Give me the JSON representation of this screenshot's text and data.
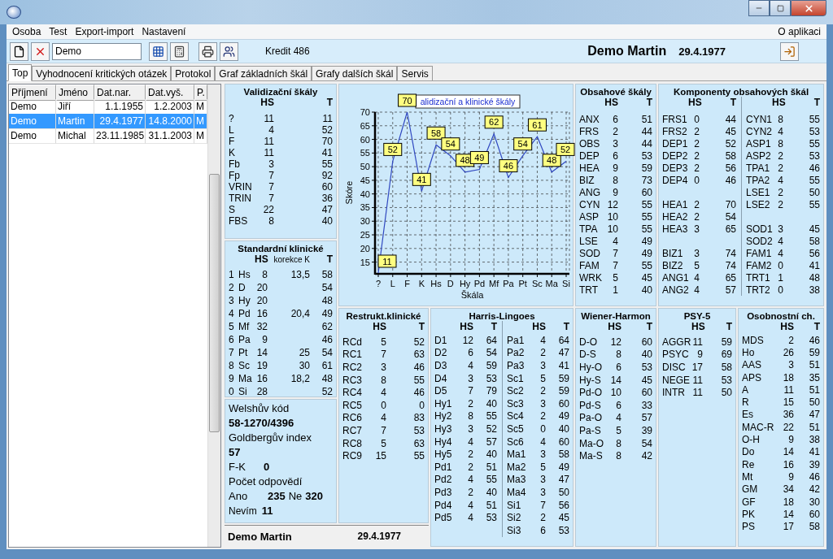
{
  "menu": {
    "items": [
      "Osoba",
      "Test",
      "Export-import",
      "Nastavení"
    ],
    "right": "O aplikaci"
  },
  "toolbar": {
    "search_value": "Demo",
    "credit": "Kredit 486",
    "person": "Demo Martin",
    "birth_date": "29.4.1977"
  },
  "tabs": [
    {
      "label": "Top",
      "selected": true
    },
    {
      "label": "Vyhodnocení kritických otázek",
      "selected": false
    },
    {
      "label": "Protokol",
      "selected": false
    },
    {
      "label": "Graf základních škál",
      "selected": false
    },
    {
      "label": "Grafy dalších škál",
      "selected": false
    },
    {
      "label": "Servis",
      "selected": false
    }
  ],
  "person_list": {
    "columns": [
      "Příjmení",
      "Jméno",
      "Dat.nar.",
      "Dat.vyš.",
      "P."
    ],
    "rows": [
      {
        "cells": [
          "Demo",
          "Jiří",
          "1.1.1955",
          "1.2.2003",
          "M"
        ],
        "selected": false
      },
      {
        "cells": [
          "Demo",
          "Martin",
          "29.4.1977",
          "14.8.2000",
          "M"
        ],
        "selected": true
      },
      {
        "cells": [
          "Demo",
          "Michal",
          "23.11.1985",
          "31.1.2003",
          "M"
        ],
        "selected": false
      }
    ]
  },
  "validation": {
    "title": "Validizační škály",
    "headers": [
      "HS",
      "T"
    ],
    "rows": [
      {
        "scale": "?",
        "hs": "11",
        "t": "11"
      },
      {
        "scale": "L",
        "hs": "4",
        "t": "52"
      },
      {
        "scale": "F",
        "hs": "11",
        "t": "70"
      },
      {
        "scale": "K",
        "hs": "11",
        "t": "41"
      },
      {
        "scale": "Fb",
        "hs": "3",
        "t": "55"
      },
      {
        "scale": "Fp",
        "hs": "7",
        "t": "92"
      },
      {
        "scale": "VRIN",
        "hs": "7",
        "t": "60"
      },
      {
        "scale": "TRIN",
        "hs": "7",
        "t": "36"
      },
      {
        "scale": "S",
        "hs": "22",
        "t": "47"
      },
      {
        "scale": "FBS",
        "hs": "8",
        "t": "40"
      }
    ]
  },
  "standard": {
    "title": "Standardní klinické",
    "headers": [
      "HS",
      "korekce K",
      "T"
    ],
    "rows": [
      {
        "no": "1",
        "scale": "Hs",
        "hs": "8",
        "k": "13,5",
        "t": "58"
      },
      {
        "no": "2",
        "scale": "D",
        "hs": "20",
        "t": "54"
      },
      {
        "no": "3",
        "scale": "Hy",
        "hs": "20",
        "t": "48"
      },
      {
        "no": "4",
        "scale": "Pd",
        "hs": "16",
        "k": "20,4",
        "t": "49"
      },
      {
        "no": "5",
        "scale": "Mf",
        "hs": "32",
        "t": "62"
      },
      {
        "no": "6",
        "scale": "Pa",
        "hs": "9",
        "t": "46"
      },
      {
        "no": "7",
        "scale": "Pt",
        "hs": "14",
        "k": "25",
        "t": "54"
      },
      {
        "no": "8",
        "scale": "Sc",
        "hs": "19",
        "k": "30",
        "t": "61"
      },
      {
        "no": "9",
        "scale": "Ma",
        "hs": "16",
        "k": "18,2",
        "t": "48"
      },
      {
        "no": "0",
        "scale": "Si",
        "hs": "28",
        "t": "52"
      }
    ]
  },
  "summary": {
    "welsh_label": "Welshův kód",
    "welsh_code": "58-1270/4396",
    "goldberg_label": "Goldbergův index",
    "goldberg_index": "57",
    "fk_label": "F-K",
    "fk_value": "0",
    "answers_label": "Počet odpovědí",
    "yes_label": "Ano",
    "yes_count": "235",
    "no_label": "Ne",
    "no_count": "320",
    "unknown_label": "Nevím",
    "unknown_count": "11"
  },
  "footer": {
    "name": "Demo Martin",
    "date": "29.4.1977"
  },
  "chart": {
    "chart_data": {
      "type": "line",
      "title": "alidizační a klinické škály",
      "xlabel": "Škála",
      "ylabel": "Skóre",
      "categories": [
        "?",
        "L",
        "F",
        "K",
        "Hs",
        "D",
        "Hy",
        "Pd",
        "Mf",
        "Pa",
        "Pt",
        "Sc",
        "Ma",
        "Si"
      ],
      "series": [
        {
          "color": "#3048c0",
          "values": [
            11,
            52,
            70,
            41,
            58,
            54,
            48,
            49,
            62,
            46,
            54,
            61,
            48,
            52
          ]
        }
      ],
      "ylim": [
        11,
        70
      ],
      "grid": true,
      "yticks": [
        15,
        20,
        25,
        30,
        35,
        40,
        45,
        50,
        55,
        60,
        65,
        70
      ],
      "data_labels": true
    }
  },
  "content": {
    "title": "Obsahové škály",
    "headers": [
      "HS",
      "T"
    ],
    "rows": [
      {
        "scale": "ANX",
        "hs": "6",
        "t": "51"
      },
      {
        "scale": "FRS",
        "hs": "2",
        "t": "44"
      },
      {
        "scale": "OBS",
        "hs": "3",
        "t": "44"
      },
      {
        "scale": "DEP",
        "hs": "6",
        "t": "53"
      },
      {
        "scale": "HEA",
        "hs": "9",
        "t": "59"
      },
      {
        "scale": "BIZ",
        "hs": "8",
        "t": "73"
      },
      {
        "scale": "ANG",
        "hs": "9",
        "t": "60"
      },
      {
        "scale": "CYN",
        "hs": "12",
        "t": "55"
      },
      {
        "scale": "ASP",
        "hs": "10",
        "t": "55"
      },
      {
        "scale": "TPA",
        "hs": "10",
        "t": "55"
      },
      {
        "scale": "LSE",
        "hs": "4",
        "t": "49"
      },
      {
        "scale": "SOD",
        "hs": "7",
        "t": "49"
      },
      {
        "scale": "FAM",
        "hs": "7",
        "t": "55"
      },
      {
        "scale": "WRK",
        "hs": "5",
        "t": "45"
      },
      {
        "scale": "TRT",
        "hs": "1",
        "t": "40"
      }
    ]
  },
  "components": {
    "title": "Komponenty obsahových škál",
    "headers": [
      "HS",
      "T",
      "HS",
      "T"
    ],
    "groups": [
      {
        "rows": [
          {
            "kind": "score",
            "scale": "FRS1",
            "hs": "0",
            "t": "44"
          },
          {
            "kind": "score",
            "scale": "FRS2",
            "hs": "2",
            "t": "45"
          },
          {
            "kind": "score",
            "scale": "DEP1",
            "hs": "2",
            "t": "52"
          },
          {
            "kind": "score",
            "scale": "DEP2",
            "hs": "2",
            "t": "58"
          },
          {
            "kind": "score",
            "scale": "DEP3",
            "hs": "2",
            "t": "56"
          },
          {
            "kind": "score",
            "scale": "DEP4",
            "hs": "0",
            "t": "46"
          },
          {
            "kind": "gap"
          },
          {
            "kind": "score",
            "scale": "HEA1",
            "hs": "2",
            "t": "70"
          },
          {
            "kind": "score",
            "scale": "HEA2",
            "hs": "2",
            "t": "54"
          },
          {
            "kind": "score",
            "scale": "HEA3",
            "hs": "3",
            "t": "65"
          },
          {
            "kind": "gap"
          },
          {
            "kind": "score",
            "scale": "BIZ1",
            "hs": "3",
            "t": "74"
          },
          {
            "kind": "score",
            "scale": "BIZ2",
            "hs": "5",
            "t": "74"
          },
          {
            "kind": "score",
            "scale": "ANG1",
            "hs": "4",
            "t": "65"
          },
          {
            "kind": "score",
            "scale": "ANG2",
            "hs": "4",
            "t": "57"
          }
        ]
      },
      {
        "rows": [
          {
            "kind": "score",
            "scale": "CYN1",
            "hs": "8",
            "t": "55"
          },
          {
            "kind": "score",
            "scale": "CYN2",
            "hs": "4",
            "t": "53"
          },
          {
            "kind": "score",
            "scale": "ASP1",
            "hs": "8",
            "t": "55"
          },
          {
            "kind": "score",
            "scale": "ASP2",
            "hs": "2",
            "t": "53"
          },
          {
            "kind": "score",
            "scale": "TPA1",
            "hs": "2",
            "t": "46"
          },
          {
            "kind": "score",
            "scale": "TPA2",
            "hs": "4",
            "t": "55"
          },
          {
            "kind": "score",
            "scale": "LSE1",
            "hs": "2",
            "t": "50"
          },
          {
            "kind": "score",
            "scale": "LSE2",
            "hs": "2",
            "t": "55"
          },
          {
            "kind": "gap"
          },
          {
            "kind": "score",
            "scale": "SOD1",
            "hs": "3",
            "t": "45"
          },
          {
            "kind": "score",
            "scale": "SOD2",
            "hs": "4",
            "t": "58"
          },
          {
            "kind": "score",
            "scale": "FAM1",
            "hs": "4",
            "t": "56"
          },
          {
            "kind": "score",
            "scale": "FAM2",
            "hs": "0",
            "t": "41"
          },
          {
            "kind": "score",
            "scale": "TRT1",
            "hs": "1",
            "t": "48"
          },
          {
            "kind": "score",
            "scale": "TRT2",
            "hs": "0",
            "t": "38"
          }
        ]
      }
    ]
  },
  "restructured": {
    "title": "Restrukt.klinické",
    "headers": [
      "HS",
      "T"
    ],
    "rows": [
      {
        "scale": "RCd",
        "hs": "5",
        "t": "52"
      },
      {
        "scale": "RC1",
        "hs": "7",
        "t": "63"
      },
      {
        "scale": "RC2",
        "hs": "3",
        "t": "46"
      },
      {
        "scale": "RC3",
        "hs": "8",
        "t": "55"
      },
      {
        "scale": "RC4",
        "hs": "4",
        "t": "46"
      },
      {
        "scale": "RC5",
        "hs": "0",
        "t": "0"
      },
      {
        "scale": "RC6",
        "hs": "4",
        "t": "83"
      },
      {
        "scale": "RC7",
        "hs": "7",
        "t": "53"
      },
      {
        "scale": "RC8",
        "hs": "5",
        "t": "63"
      },
      {
        "scale": "RC9",
        "hs": "15",
        "t": "55"
      }
    ]
  },
  "harris": {
    "title": "Harris-Lingoes",
    "headers": [
      "HS",
      "T",
      "HS",
      "T"
    ],
    "groups": [
      {
        "rows": [
          {
            "scale": "D1",
            "hs": "12",
            "t": "64"
          },
          {
            "scale": "D2",
            "hs": "6",
            "t": "54"
          },
          {
            "scale": "D3",
            "hs": "4",
            "t": "59"
          },
          {
            "scale": "D4",
            "hs": "3",
            "t": "53"
          },
          {
            "scale": "D5",
            "hs": "7",
            "t": "79"
          },
          {
            "scale": "Hy1",
            "hs": "2",
            "t": "40"
          },
          {
            "scale": "Hy2",
            "hs": "8",
            "t": "55"
          },
          {
            "scale": "Hy3",
            "hs": "3",
            "t": "52"
          },
          {
            "scale": "Hy4",
            "hs": "4",
            "t": "57"
          },
          {
            "scale": "Hy5",
            "hs": "2",
            "t": "40"
          },
          {
            "scale": "Pd1",
            "hs": "2",
            "t": "51"
          },
          {
            "scale": "Pd2",
            "hs": "4",
            "t": "55"
          },
          {
            "scale": "Pd3",
            "hs": "2",
            "t": "40"
          },
          {
            "scale": "Pd4",
            "hs": "4",
            "t": "51"
          },
          {
            "scale": "Pd5",
            "hs": "4",
            "t": "53"
          }
        ]
      },
      {
        "rows": [
          {
            "scale": "Pa1",
            "hs": "4",
            "t": "64"
          },
          {
            "scale": "Pa2",
            "hs": "2",
            "t": "47"
          },
          {
            "scale": "Pa3",
            "hs": "3",
            "t": "41"
          },
          {
            "scale": "Sc1",
            "hs": "5",
            "t": "59"
          },
          {
            "scale": "Sc2",
            "hs": "2",
            "t": "59"
          },
          {
            "scale": "Sc3",
            "hs": "3",
            "t": "60"
          },
          {
            "scale": "Sc4",
            "hs": "2",
            "t": "49"
          },
          {
            "scale": "Sc5",
            "hs": "0",
            "t": "40"
          },
          {
            "scale": "Sc6",
            "hs": "4",
            "t": "60"
          },
          {
            "scale": "Ma1",
            "hs": "3",
            "t": "58"
          },
          {
            "scale": "Ma2",
            "hs": "5",
            "t": "49"
          },
          {
            "scale": "Ma3",
            "hs": "3",
            "t": "47"
          },
          {
            "scale": "Ma4",
            "hs": "3",
            "t": "50"
          },
          {
            "scale": "Si1",
            "hs": "7",
            "t": "56"
          },
          {
            "scale": "Si2",
            "hs": "2",
            "t": "45"
          },
          {
            "scale": "Si3",
            "hs": "6",
            "t": "53"
          }
        ]
      }
    ]
  },
  "wiener": {
    "title": "Wiener-Harmon",
    "headers": [
      "HS",
      "T"
    ],
    "rows": [
      {
        "scale": "D-O",
        "hs": "12",
        "t": "60"
      },
      {
        "scale": "D-S",
        "hs": "8",
        "t": "40"
      },
      {
        "scale": "Hy-O",
        "hs": "6",
        "t": "53"
      },
      {
        "scale": "Hy-S",
        "hs": "14",
        "t": "45"
      },
      {
        "scale": "Pd-O",
        "hs": "10",
        "t": "60"
      },
      {
        "scale": "Pd-S",
        "hs": "6",
        "t": "33"
      },
      {
        "scale": "Pa-O",
        "hs": "4",
        "t": "57"
      },
      {
        "scale": "Pa-S",
        "hs": "5",
        "t": "39"
      },
      {
        "scale": "Ma-O",
        "hs": "8",
        "t": "54"
      },
      {
        "scale": "Ma-S",
        "hs": "8",
        "t": "42"
      }
    ]
  },
  "psy5": {
    "title": "PSY-5",
    "headers": [
      "HS",
      "T"
    ],
    "rows": [
      {
        "scale": "AGGR",
        "hs": "11",
        "t": "59"
      },
      {
        "scale": "PSYC",
        "hs": "9",
        "t": "69"
      },
      {
        "scale": "DISC",
        "hs": "17",
        "t": "58"
      },
      {
        "scale": "NEGE",
        "hs": "11",
        "t": "53"
      },
      {
        "scale": "INTR",
        "hs": "11",
        "t": "50"
      }
    ]
  },
  "personality": {
    "title": "Osobnostní ch.",
    "headers": [
      "HS",
      "T"
    ],
    "rows": [
      {
        "scale": "MDS",
        "hs": "2",
        "t": "46"
      },
      {
        "scale": "Ho",
        "hs": "26",
        "t": "59"
      },
      {
        "scale": "AAS",
        "hs": "3",
        "t": "51"
      },
      {
        "scale": "APS",
        "hs": "18",
        "t": "35"
      },
      {
        "scale": "A",
        "hs": "11",
        "t": "51"
      },
      {
        "scale": "R",
        "hs": "15",
        "t": "50"
      },
      {
        "scale": "Es",
        "hs": "36",
        "t": "47"
      },
      {
        "scale": "MAC-R",
        "hs": "22",
        "t": "51"
      },
      {
        "scale": "O-H",
        "hs": "9",
        "t": "38"
      },
      {
        "scale": "Do",
        "hs": "14",
        "t": "41"
      },
      {
        "scale": "Re",
        "hs": "16",
        "t": "39"
      },
      {
        "scale": "Mt",
        "hs": "9",
        "t": "46"
      },
      {
        "scale": "GM",
        "hs": "34",
        "t": "42"
      },
      {
        "scale": "GF",
        "hs": "18",
        "t": "30"
      },
      {
        "scale": "PK",
        "hs": "14",
        "t": "60"
      },
      {
        "scale": "PS",
        "hs": "17",
        "t": "58"
      }
    ]
  }
}
